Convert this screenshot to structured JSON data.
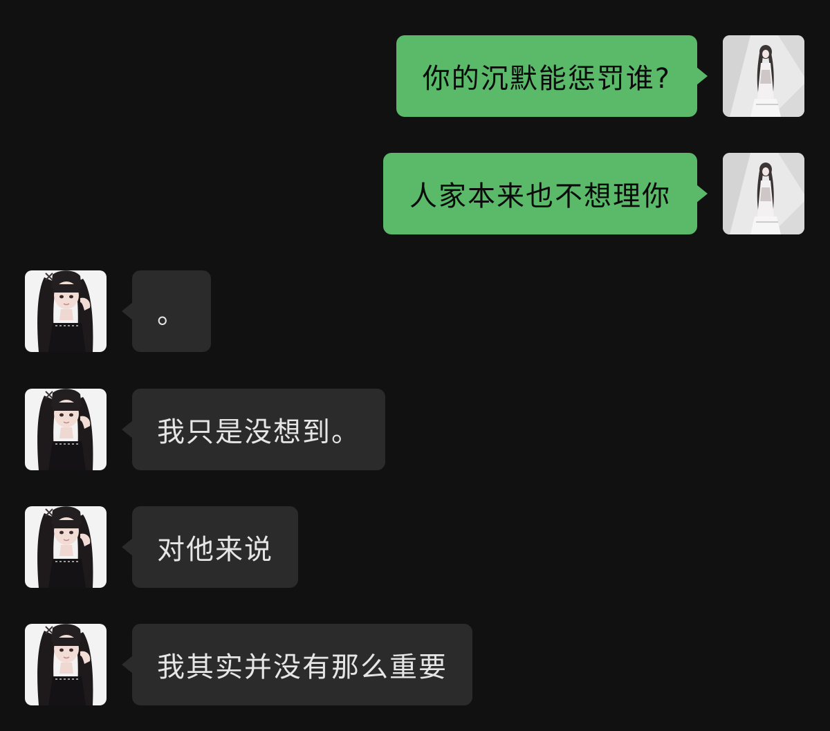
{
  "chat": {
    "messages": [
      {
        "direction": "sent",
        "text": "你的沉默能惩罚谁?"
      },
      {
        "direction": "sent",
        "text": "人家本来也不想理你"
      },
      {
        "direction": "received",
        "text": "。"
      },
      {
        "direction": "received",
        "text": "我只是没想到。"
      },
      {
        "direction": "received",
        "text": "对他来说"
      },
      {
        "direction": "received",
        "text": "我其实并没有那么重要"
      }
    ]
  },
  "colors": {
    "background": "#111111",
    "sent_bubble": "#5aba6a",
    "received_bubble": "#2b2b2b"
  }
}
